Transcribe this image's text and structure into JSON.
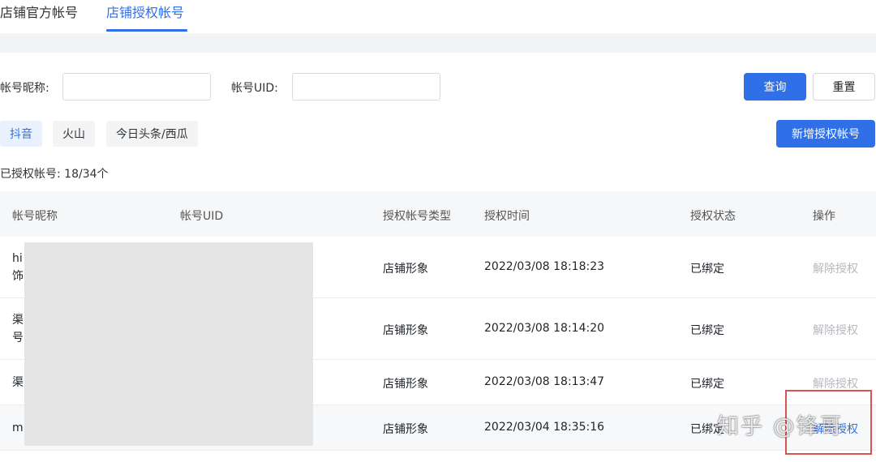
{
  "tabs": [
    {
      "label": "店铺官方帐号",
      "active": false
    },
    {
      "label": "店铺授权帐号",
      "active": true
    }
  ],
  "filters": {
    "nickname_label": "帐号昵称:",
    "nickname_value": "",
    "uid_label": "帐号UID:",
    "uid_value": "",
    "query_label": "查询",
    "reset_label": "重置"
  },
  "platforms": [
    {
      "label": "抖音",
      "active": true
    },
    {
      "label": "火山",
      "active": false
    },
    {
      "label": "今日头条/西瓜",
      "active": false
    }
  ],
  "add_button_label": "新增授权帐号",
  "authorized_count": "已授权帐号: 18/34个",
  "table": {
    "columns": [
      "帐号昵称",
      "帐号UID",
      "授权帐号类型",
      "授权时间",
      "授权状态",
      "操作"
    ],
    "rows": [
      {
        "nickname_line1": "hi",
        "nickname_line2": "饰",
        "type": "店铺形象",
        "time": "2022/03/08 18:18:23",
        "status": "已绑定",
        "action": "解除授权"
      },
      {
        "nickname_line1": "渠",
        "nickname_line2": "号",
        "type": "店铺形象",
        "time": "2022/03/08 18:14:20",
        "status": "已绑定",
        "action": "解除授权"
      },
      {
        "nickname_line1": "渠",
        "nickname_line2": "",
        "type": "店铺形象",
        "time": "2022/03/08 18:13:47",
        "status": "已绑定",
        "action": "解除授权"
      },
      {
        "nickname_line1": "m",
        "nickname_line2": "",
        "type": "店铺形象",
        "time": "2022/03/04 18:35:16",
        "status": "已绑定",
        "action": "解除授权"
      }
    ]
  },
  "watermark": "知乎 @锋哥",
  "colors": {
    "accent": "#2f6fe8",
    "highlight": "#d9534f"
  }
}
